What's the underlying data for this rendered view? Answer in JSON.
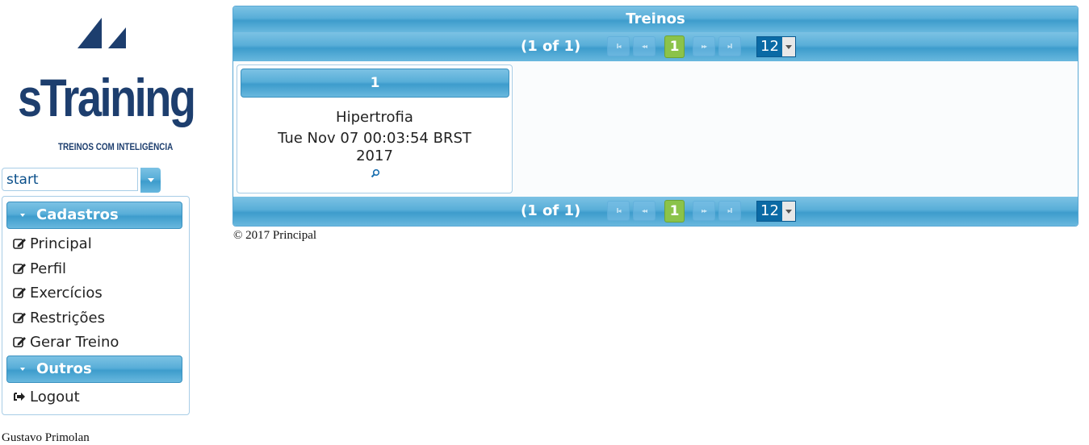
{
  "logo": {
    "brand": "sTraining",
    "tagline": "TREINOS COM INTELIGÊNCIA"
  },
  "theme_select": {
    "value": "start"
  },
  "menu": {
    "sections": [
      {
        "title": "Cadastros",
        "items": [
          "Principal",
          "Perfil",
          "Exercícios",
          "Restrições",
          "Gerar Treino"
        ]
      },
      {
        "title": "Outros",
        "items": [
          "Logout"
        ]
      }
    ]
  },
  "author": "Gustavo Primolan",
  "panel": {
    "title": "Treinos",
    "paginator": {
      "count_text": "(1 of 1)",
      "current_page": "1",
      "rows_per_page": "12",
      "first_glyph": "I◂",
      "prev_glyph": "◂◂",
      "next_glyph": "▸▸",
      "last_glyph": "▸I"
    },
    "cards": [
      {
        "header": "1",
        "name": "Hipertrofia",
        "date_line1": "Tue Nov 07 00:03:54 BRST",
        "date_line2": "2017"
      }
    ]
  },
  "footer": "© 2017 Principal",
  "colors": {
    "accent_blue": "#4aa6d6",
    "page_active": "#8bc34a",
    "logo_navy": "#1d3e6e"
  }
}
